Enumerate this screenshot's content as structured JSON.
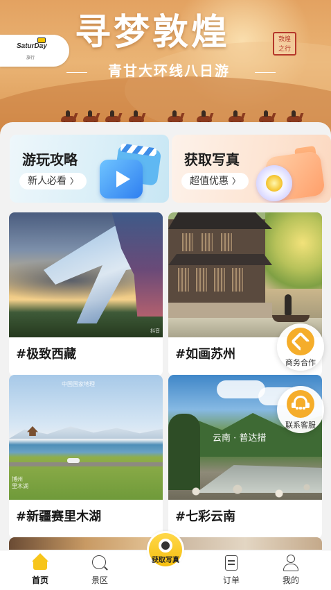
{
  "banner": {
    "title": "寻梦敦煌",
    "subtitle": "青甘大环线八日游",
    "seal_text": "敦煌之行",
    "logo": {
      "brand": "SaturDay",
      "sub": "旅行"
    }
  },
  "promos": [
    {
      "title": "游玩攻略",
      "pill": "新人必看",
      "icon": "play-video-icon"
    },
    {
      "title": "获取写真",
      "pill": "超值优惠",
      "icon": "camera-icon"
    }
  ],
  "destinations": [
    {
      "label": "#极致西藏",
      "watermark": "抖音"
    },
    {
      "label": "#如画苏州"
    },
    {
      "label": "#新疆赛里木湖",
      "watermark_top": "中国国家地理",
      "watermark_bl": "博州\n里木湖"
    },
    {
      "label": "#七彩云南",
      "caption": "云南 · 普达措"
    }
  ],
  "floating": {
    "business": "商务合作",
    "service": "联系客服"
  },
  "tabs": [
    {
      "label": "首页",
      "icon": "home-icon",
      "active": true
    },
    {
      "label": "景区",
      "icon": "scenic-search-icon"
    },
    {
      "label": "获取写真",
      "icon": "camera-lens-icon",
      "center": true
    },
    {
      "label": "订单",
      "icon": "order-doc-icon"
    },
    {
      "label": "我的",
      "icon": "profile-icon"
    }
  ],
  "colors": {
    "accent": "#f7c51b",
    "floating_icon": "#f5ad2a",
    "banner": "#e3a261"
  }
}
